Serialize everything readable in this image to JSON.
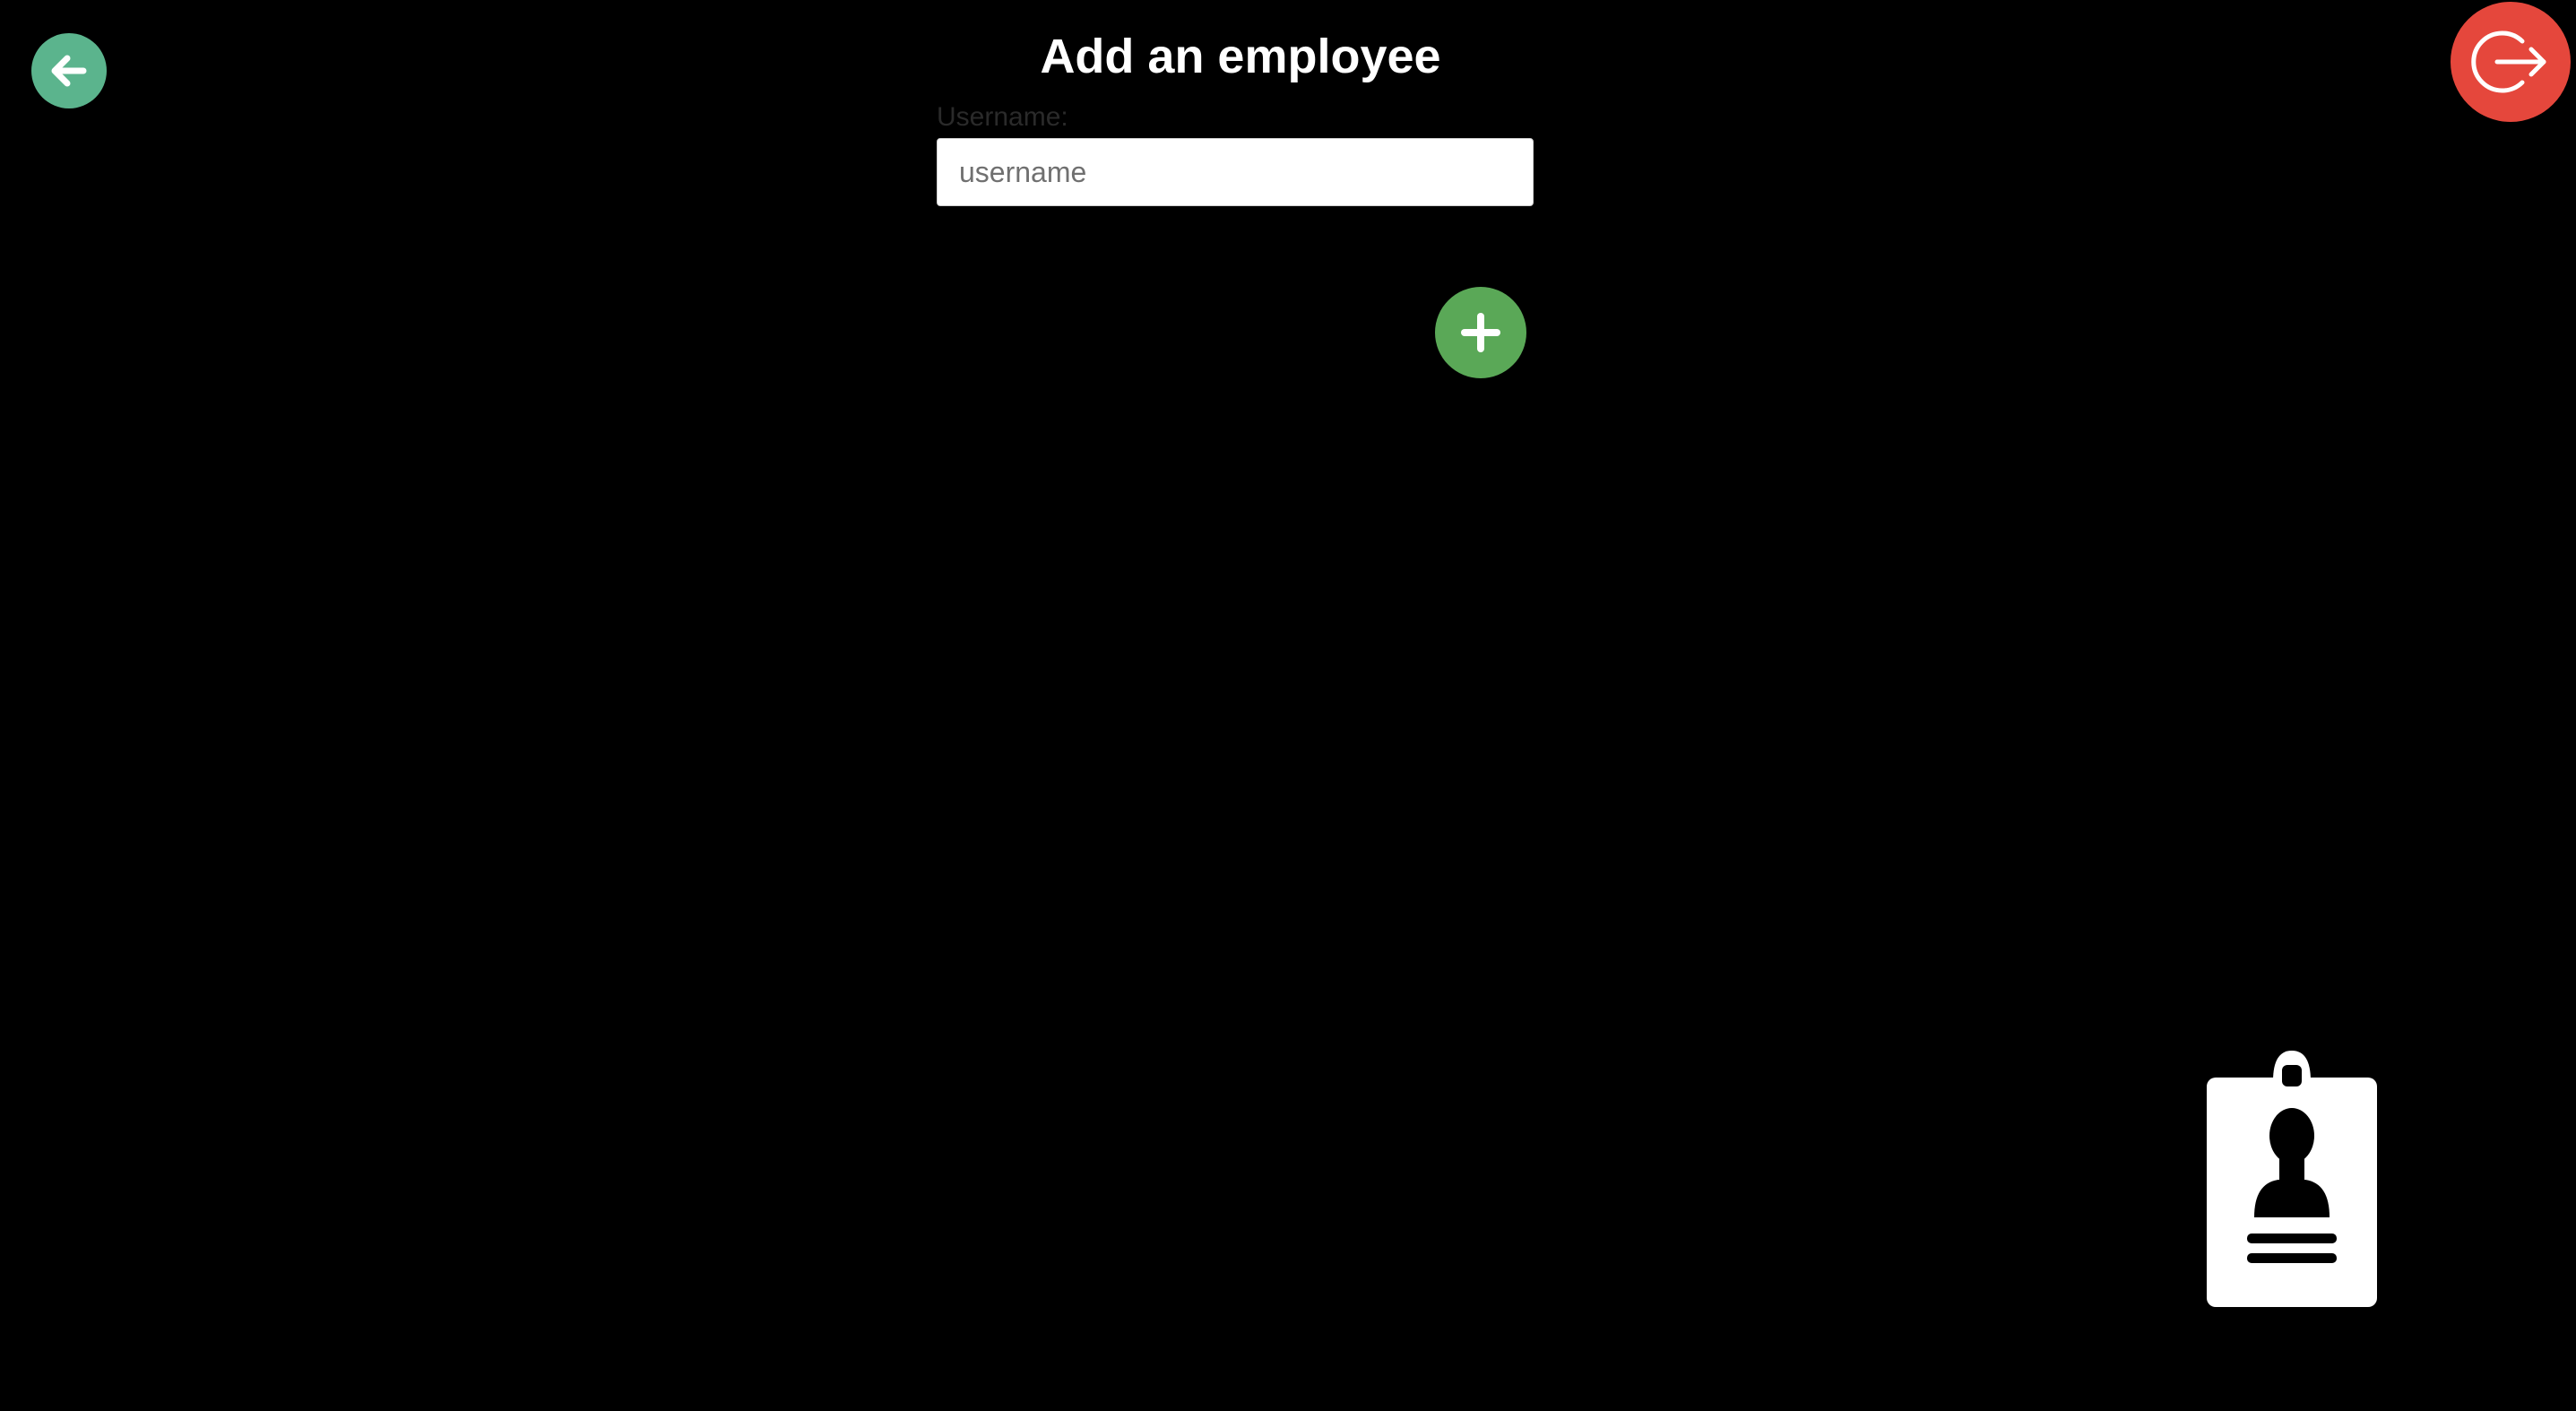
{
  "header": {
    "title": "Add an employee"
  },
  "form": {
    "username_label": "Username:",
    "username_placeholder": "username",
    "username_value": ""
  },
  "icons": {
    "back": "arrow-left-icon",
    "logout": "logout-icon",
    "add": "plus-icon",
    "illustration": "employee-badge-icon"
  },
  "colors": {
    "background": "#000000",
    "back_button": "#5bb48d",
    "logout_button": "#e5473c",
    "add_button": "#5aa857"
  }
}
